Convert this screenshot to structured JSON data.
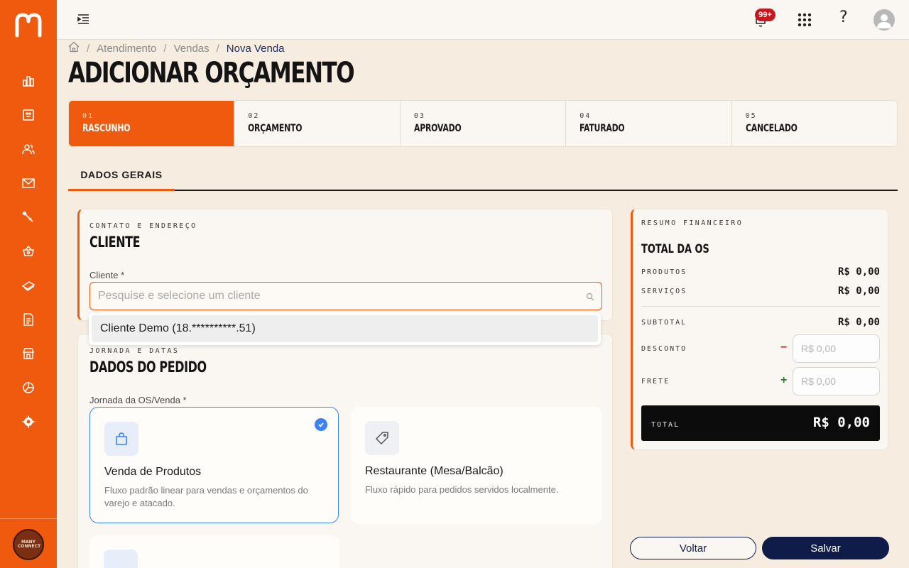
{
  "breadcrumb": {
    "items": [
      "Atendimento",
      "Vendas"
    ],
    "current": "Nova Venda"
  },
  "page_title": "ADICIONAR ORÇAMENTO",
  "notifications": {
    "count": "99+"
  },
  "sidebar": {
    "brand_icon": "m-logo-icon",
    "items": [
      {
        "icon": "bar-chart-icon"
      },
      {
        "icon": "id-card-icon"
      },
      {
        "icon": "users-icon"
      },
      {
        "icon": "mail-icon"
      },
      {
        "icon": "wrench-icon"
      },
      {
        "icon": "basket-icon"
      },
      {
        "icon": "money-icon"
      },
      {
        "icon": "document-icon"
      },
      {
        "icon": "store-icon"
      },
      {
        "icon": "pie-chart-icon"
      },
      {
        "icon": "gear-icon"
      }
    ],
    "org_badge": "MANY CONNECT"
  },
  "stepper": [
    {
      "num": "01",
      "label": "RASCUNHO",
      "active": true
    },
    {
      "num": "02",
      "label": "ORÇAMENTO"
    },
    {
      "num": "03",
      "label": "APROVADO"
    },
    {
      "num": "04",
      "label": "FATURADO"
    },
    {
      "num": "05",
      "label": "CANCELADO"
    }
  ],
  "tabs": {
    "active": "DADOS GERAIS"
  },
  "client_section": {
    "eyebrow": "CONTATO E ENDEREÇO",
    "title": "CLIENTE",
    "field_label": "Cliente *",
    "placeholder": "Pesquise e selecione um cliente",
    "dropdown_option": "Cliente Demo (18.**********.51)"
  },
  "order_section": {
    "eyebrow": "JORNADA E DATAS",
    "title": "DADOS DO PEDIDO",
    "field_label": "Jornada da OS/Venda *",
    "options": [
      {
        "title": "Venda de Produtos",
        "desc": "Fluxo padrão linear para vendas e orçamentos do varejo e atacado.",
        "selected": true
      },
      {
        "title": "Restaurante (Mesa/Balcão)",
        "desc": "Fluxo rápido para pedidos servidos localmente."
      }
    ]
  },
  "financial": {
    "eyebrow": "RESUMO FINANCEIRO",
    "title": "TOTAL DA OS",
    "produtos_label": "PRODUTOS",
    "produtos_value": "R$ 0,00",
    "servicos_label": "SERVIÇOS",
    "servicos_value": "R$ 0,00",
    "subtotal_label": "SUBTOTAL",
    "subtotal_value": "R$ 0,00",
    "desconto_label": "DESCONTO",
    "desconto_sign": "−",
    "desconto_placeholder": "R$ 0,00",
    "frete_label": "FRETE",
    "frete_sign": "+",
    "frete_placeholder": "R$ 0,00",
    "total_label": "TOTAL",
    "total_value": "R$ 0,00"
  },
  "actions": {
    "back": "Voltar",
    "save": "Salvar"
  },
  "colors": {
    "accent": "#ef5a0f",
    "navy": "#0f1c4a",
    "selected": "#3b82f6"
  }
}
